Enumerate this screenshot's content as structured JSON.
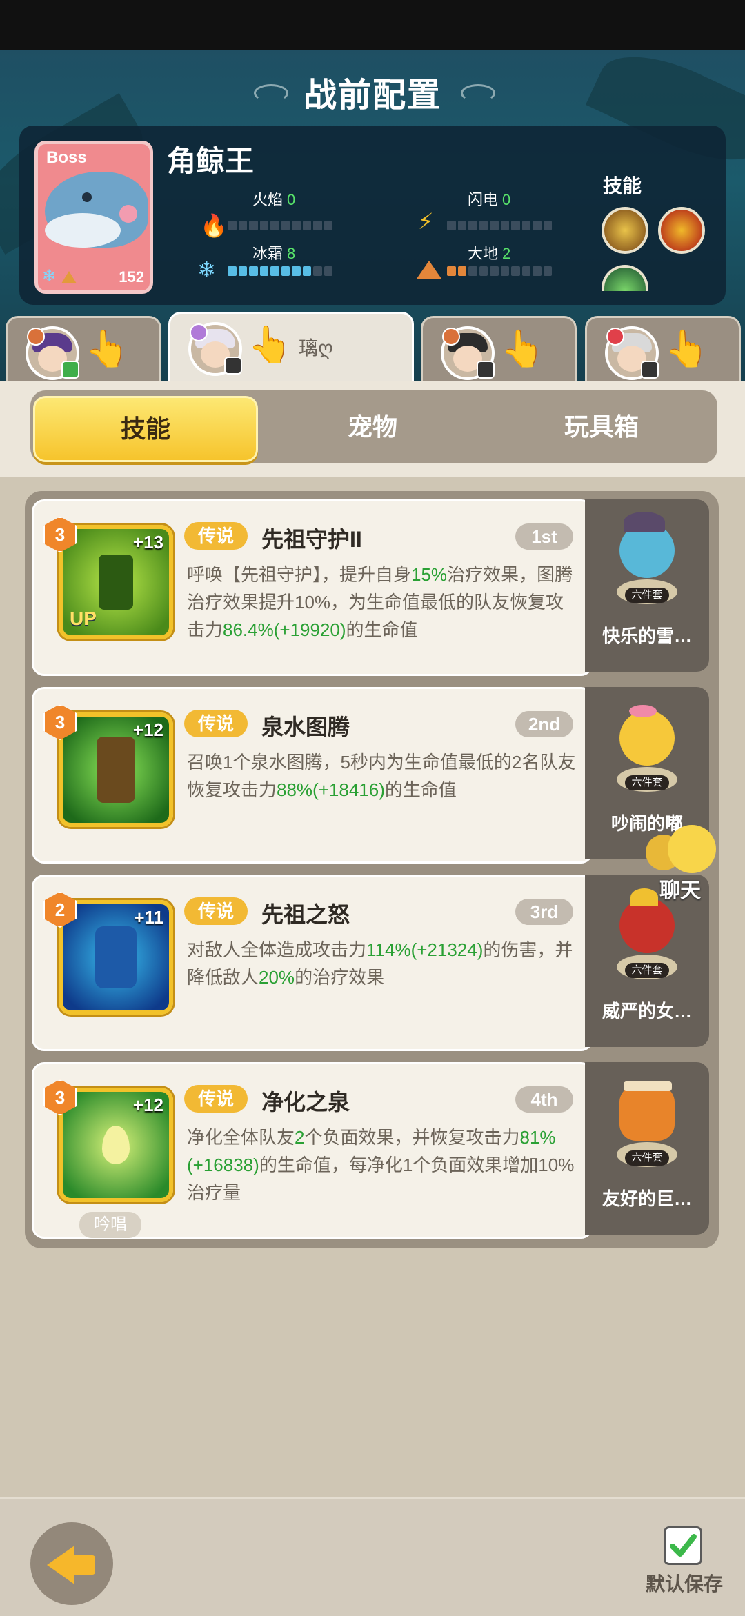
{
  "header": {
    "title": "战前配置"
  },
  "boss": {
    "badge": "Boss",
    "name": "角鲸王",
    "level": "152",
    "skills_label": "技能",
    "stats": [
      {
        "name": "火焰",
        "value": "0"
      },
      {
        "name": "闪电",
        "value": "0"
      },
      {
        "name": "冰霜",
        "value": "8"
      },
      {
        "name": "大地",
        "value": "2"
      }
    ]
  },
  "hero_tabs": [
    {
      "name": ""
    },
    {
      "name": "璃ღ"
    },
    {
      "name": ""
    },
    {
      "name": ""
    }
  ],
  "segments": [
    "技能",
    "宠物",
    "玩具箱"
  ],
  "skills": [
    {
      "level": "3",
      "plus": "+13",
      "rarity": "传说",
      "name": "先祖守护II",
      "rank": "1st",
      "d1": "呼唤【先祖守护】，提升自身",
      "d1g": "15%",
      "d2": "治疗效果，图腾治疗效果提升10%，为生命值最低的队友恢复攻击力",
      "d2g": "86.4%(+19920)",
      "d3": "的生命值",
      "pet": "快乐的雪…",
      "set": "六件套",
      "up": "UP"
    },
    {
      "level": "3",
      "plus": "+12",
      "rarity": "传说",
      "name": "泉水图腾",
      "rank": "2nd",
      "d1": "召唤1个泉水图腾，5秒内为生命值最低的2名队友恢复攻击力",
      "d1g": "88%(+18416)",
      "d2": "的生命值",
      "pet": "吵闹的嘟",
      "set": "六件套"
    },
    {
      "level": "2",
      "plus": "+11",
      "rarity": "传说",
      "name": "先祖之怒",
      "rank": "3rd",
      "d1": "对敌人全体造成攻击力",
      "d1g": "114%(+21324)",
      "d2": "的伤害，并降低敌人",
      "d2g": "20%",
      "d3": "的治疗效果",
      "pet": "威严的女…",
      "set": "六件套"
    },
    {
      "level": "3",
      "plus": "+12",
      "rarity": "传说",
      "name": "净化之泉",
      "rank": "4th",
      "d1": "净化全体队友",
      "d1g": "2",
      "d2": "个负面效果，并恢复攻击力",
      "d2g": "81%(+16838)",
      "d3": "的生命值，每净化1个负面效果增加10%治疗量",
      "pet": "友好的巨…",
      "set": "六件套",
      "chant": "吟唱"
    }
  ],
  "chat": {
    "label": "聊天"
  },
  "footer": {
    "save_label": "默认保存"
  }
}
